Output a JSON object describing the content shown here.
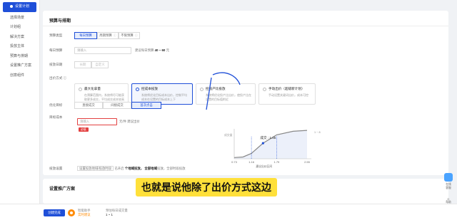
{
  "sidebar": {
    "items": [
      {
        "label": "设置计划",
        "active": true
      },
      {
        "label": "选择场景"
      },
      {
        "label": "计划组"
      },
      {
        "label": "解决方案"
      },
      {
        "label": "投放主体"
      },
      {
        "label": "预算与排期"
      },
      {
        "label": "设置推广方案"
      },
      {
        "label": "创意组件"
      }
    ]
  },
  "budget_section": {
    "title": "预算与排期",
    "budget_type": {
      "label": "预算类型",
      "options": [
        "每日预算",
        "周期预算",
        "不限预算"
      ],
      "selected": 0
    },
    "daily_budget": {
      "label": "每日预算",
      "placeholder": "请输入",
      "hint_prefix": "建议每日预算",
      "hint_value": "40 ~ 60",
      "hint_unit": "元"
    },
    "schedule": {
      "label": "投放日期",
      "options": [
        "长期",
        "自定义"
      ]
    },
    "bid_method": {
      "label": "出价方式",
      "cards": [
        {
          "title": "最大化拿量",
          "desc": "在预算范围内，系统将尽可能获取更多成交，平均成交成本较高"
        },
        {
          "title": "控成本投放",
          "desc": "系统将优化目标成本出价，控制平均成本在设置的目标成本上下",
          "selected": true
        },
        {
          "title": "控投产比投放",
          "desc": "系统将优化投产比出价，使投产比在设置的目标值附近"
        },
        {
          "title": "手动出价（超级新计划）",
          "desc": "手动设置关键词出价，成本可控"
        }
      ]
    },
    "bid_target": {
      "label": "优化目标",
      "options": [
        "直接成交",
        "间接成交",
        "首次点击"
      ],
      "selected": 2
    },
    "target_cost": {
      "label": "目标成本",
      "placeholder": "请输入",
      "unit_hint": "元/件 建议出价",
      "error_badge": "必填"
    },
    "schedule_setting": {
      "label": "投放设置",
      "text_1": "设置投放地域/投放时段",
      "text_2": "已开启",
      "text_3": "个地域投放，",
      "text_4": "全部地域",
      "text_5": "投放，全部时段投放"
    }
  },
  "chart_data": {
    "type": "line",
    "annotation": "成交 : 1.45",
    "right_label": "1 ~ 8",
    "ylabel": "成交量",
    "xlabel": "建议出价区间",
    "x_ticks": [
      "0.73",
      "1.16",
      "1.79",
      "2.55"
    ],
    "x": [
      0.73,
      0.95,
      1.16,
      1.45,
      1.79,
      2.2,
      2.55
    ],
    "y": [
      0.04,
      0.06,
      0.18,
      0.52,
      0.8,
      0.92,
      0.95
    ],
    "range_low": 1.16,
    "range_high": 1.79,
    "xlim": [
      0.73,
      2.55
    ],
    "ylim": [
      0,
      1
    ],
    "colors": {
      "line": "#888888",
      "shade": "#dfe6f6",
      "range": "#1f4fd8"
    }
  },
  "plan_section": {
    "title": "设置推广方案"
  },
  "bottom_bar": {
    "primary_button": "创建完成",
    "assist_label_1": "智能助手",
    "assist_label_2": "实时建议",
    "summary_label": "预估每日成交量",
    "summary_value": "1 ~ 1"
  },
  "float_help": {
    "label_1": "在线",
    "label_2": "客服",
    "label_3": "帮助"
  },
  "subtitle": "也就是说他除了出价方式这边"
}
